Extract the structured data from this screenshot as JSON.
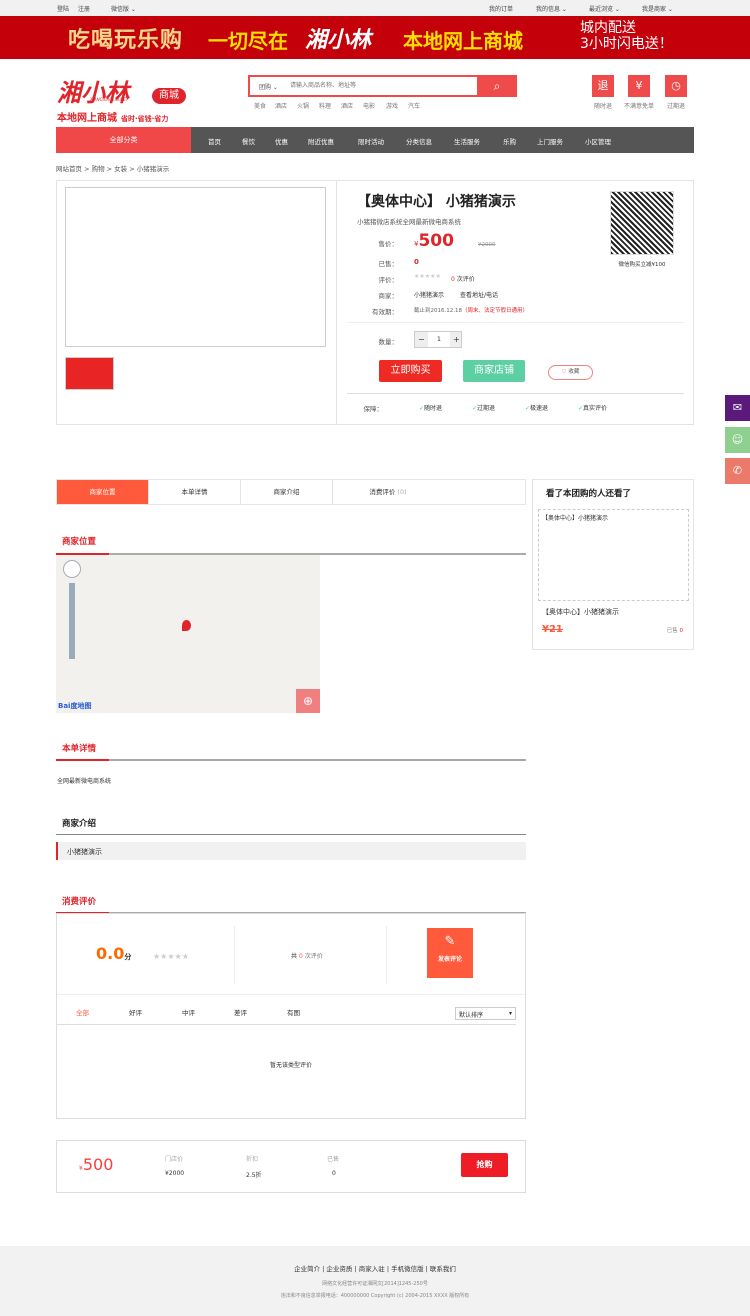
{
  "topbar": {
    "login": "登陆",
    "register": "注册",
    "wechat": "微信版 ⌄",
    "orders": "我的订单",
    "my_info": "我的信息 ⌄",
    "recent": "最近浏览 ⌄",
    "merchant": "我是商家 ⌄"
  },
  "banner": {
    "slogan1": "吃喝玩乐购",
    "slogan2": "一切尽在",
    "brand": "湘小林",
    "slogan3": "本地网上商城",
    "delivery1": "城内配送",
    "delivery2": "3小时闪电送！"
  },
  "logo": {
    "name": "湘小林",
    "badge": "商城",
    "domain": "XIANGXIAOLIN.NET",
    "tagline": "本地网上商城",
    "tagline2": "省时·省钱·省力"
  },
  "search": {
    "category": "团购 ⌄",
    "placeholder": "请输入商品名称、地址等",
    "hot": [
      "美食",
      "酒店",
      "火锅",
      "料理",
      "酒店",
      "电影",
      "游戏",
      "汽车"
    ]
  },
  "quick": [
    {
      "icon": "退",
      "label": "随时退"
    },
    {
      "icon": "¥",
      "label": "不满意免单"
    },
    {
      "icon": "◷",
      "label": "过期退"
    }
  ],
  "nav": {
    "all": "全部分类",
    "items": [
      "首页",
      "餐饮",
      "优惠",
      "附近优惠",
      "限时活动",
      "分类信息",
      "生活服务",
      "乐购",
      "上门服务",
      "小区管理"
    ]
  },
  "breadcrumb": "网站首页 > 购物 > 女装 > 小猪猪演示",
  "product": {
    "title": "【奥体中心】 小猪猪演示",
    "subtitle": "小猪猪微店系统全网最新微电商系统",
    "price_label": "售价：",
    "currency": "¥",
    "price": "500",
    "orig_price": "¥2000",
    "sold_label": "已售：",
    "sold": "0",
    "rating_label": "评价：",
    "rating_count": "0",
    "rating_suffix": "次评价",
    "merchant_label": "商家：",
    "merchant": "小猪猪演示",
    "merchant_link": "查看地址/电话",
    "valid_label": "有效期：",
    "valid": "截止到2016.12.18",
    "valid_note": "（周末、法定节假日通用）",
    "qty_label": "数量：",
    "qty": "1",
    "buy": "立即购买",
    "shop": "商家店铺",
    "fav": "收藏",
    "qr_caption": "微信购买立减¥100",
    "guarantee_label": "保障：",
    "guarantees": [
      "随时退",
      "过期退",
      "极速退",
      "真实评价"
    ]
  },
  "tabs": [
    {
      "label": "商家位置"
    },
    {
      "label": "本单详情"
    },
    {
      "label": "商家介绍"
    },
    {
      "label": "消费评价",
      "count": "(0)"
    }
  ],
  "sidebar": {
    "title": "看了本团购的人还看了",
    "item_alt": "【奥体中心】小猪猪演示",
    "item_name": "【奥体中心】小猪猪演示",
    "item_price": "¥21",
    "item_sold": "已售",
    "item_sold_count": "0"
  },
  "sections": {
    "location": "商家位置",
    "details": "本单详情",
    "details_text": "全网最新微电商系统",
    "intro": "商家介绍",
    "intro_text": "小猪猪演示",
    "reviews": "消费评价"
  },
  "map": {
    "logo": "Bai度地图"
  },
  "reviews": {
    "score": "0.0",
    "score_unit": "分",
    "total_prefix": "共",
    "total": "0",
    "total_suffix": "次评价",
    "write": "发表评论",
    "filters": [
      "全部",
      "好评",
      "中评",
      "差评",
      "有图"
    ],
    "sort": "默认排序",
    "empty": "暂无该类型评价"
  },
  "buybar": {
    "currency": "¥",
    "price": "500",
    "orig_label": "门店价",
    "orig": "¥2000",
    "discount_label": "折扣",
    "discount": "2.5折",
    "sold_label": "已售",
    "sold": "0",
    "button": "抢购"
  },
  "footer": {
    "links": [
      "企业简介",
      "企业资质",
      "商家入驻",
      "手机微信版",
      "联系我们"
    ],
    "license": "网络文化经营许可证湘网文[2014]1245-250号",
    "copyright": "违法和不良信息举报电话：400000000 Copyright (c) 2004-2015 XXXX 版权所有"
  },
  "colors": {
    "accent": "#e0242b",
    "orange": "#ff5a3c",
    "green": "#5ccfa3",
    "nav": "#555555"
  }
}
